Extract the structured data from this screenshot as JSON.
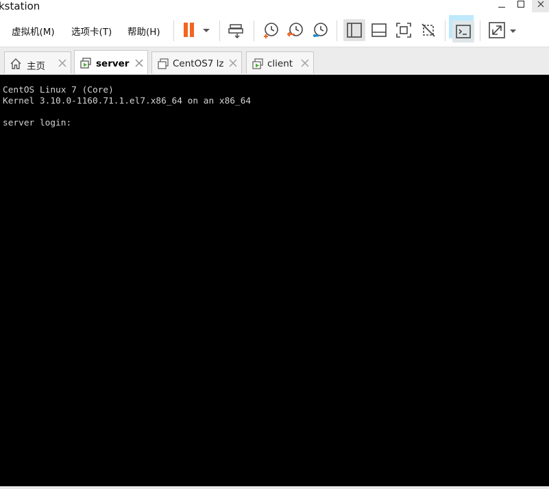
{
  "window": {
    "title": "kstation",
    "controls": [
      "minimize",
      "maximize",
      "close"
    ]
  },
  "menu": {
    "vm_label": "虚拟机(M)",
    "tabs_label": "选项卡(T)",
    "help_label": "帮助(H)"
  },
  "toolbar": {
    "accent_color": "#f26522",
    "highlight_color": "#bfe9fb",
    "buttons": [
      "pause-icon",
      "send-ctrl-alt-del-icon",
      "snapshot-icon",
      "revert-snapshot-icon",
      "snapshot-manager-icon",
      "show-library-icon",
      "thumbnail-bar-icon",
      "fit-guest-icon",
      "no-stretch-icon",
      "console-view-icon",
      "fullscreen-icon"
    ]
  },
  "tabs": [
    {
      "label": "主页",
      "icon": "home-icon",
      "active": false
    },
    {
      "label": "server",
      "icon": "vm-running-icon",
      "active": true
    },
    {
      "label": "CentOS7 lz",
      "icon": "vm-icon",
      "active": false
    },
    {
      "label": "client",
      "icon": "vm-running-icon",
      "active": false
    }
  ],
  "console": {
    "lines": [
      "CentOS Linux 7 (Core)",
      "Kernel 3.10.0-1160.71.1.el7.x86_64 on an x86_64",
      "",
      "server login:"
    ],
    "background": "#000000",
    "foreground": "#d4d4d4"
  }
}
